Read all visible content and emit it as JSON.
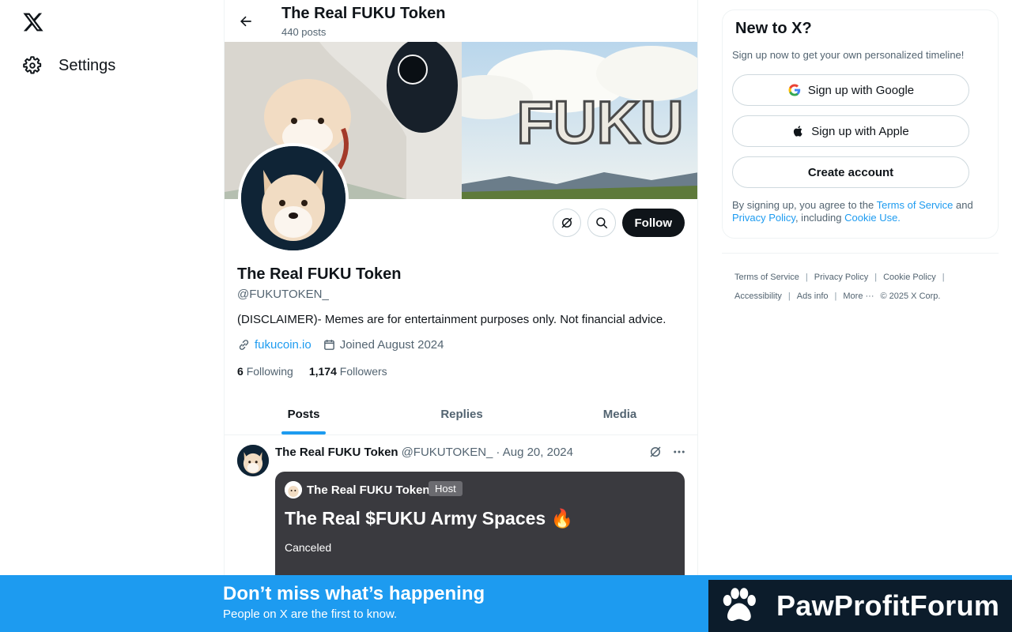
{
  "nav": {
    "settings_label": "Settings"
  },
  "header": {
    "title": "The Real FUKU Token",
    "posts_count": "440 posts"
  },
  "banner": {
    "text": "FUKU"
  },
  "profile": {
    "name": "The Real FUKU Token",
    "handle": "@FUKUTOKEN_",
    "bio": "(DISCLAIMER)- Memes are for entertainment purposes only. Not financial advice.",
    "website": "fukucoin.io",
    "joined": "Joined August 2024",
    "following_count": "6",
    "following_label": "Following",
    "followers_count": "1,174",
    "followers_label": "Followers",
    "follow_label": "Follow"
  },
  "tabs": [
    {
      "label": "Posts",
      "active": true
    },
    {
      "label": "Replies",
      "active": false
    },
    {
      "label": "Media",
      "active": false
    }
  ],
  "post": {
    "author": "The Real FUKU Token",
    "handle": "@FUKUTOKEN_",
    "date": "· Aug 20, 2024",
    "space": {
      "host_name": "The Real FUKU Token",
      "host_badge": "Host",
      "title": "The Real $FUKU Army Spaces 🔥",
      "status": "Canceled"
    }
  },
  "signup": {
    "title": "New to X?",
    "subtitle": "Sign up now to get your own personalized timeline!",
    "google": "Sign up with Google",
    "apple": "Sign up with Apple",
    "create": "Create account",
    "legal_prefix": "By signing up, you agree to the ",
    "terms": "Terms of Service",
    "and": " and ",
    "privacy": "Privacy Policy",
    "including": ", including ",
    "cookie": "Cookie Use."
  },
  "footer": {
    "terms": "Terms of Service",
    "privacy": "Privacy Policy",
    "cookie": "Cookie Policy",
    "accessibility": "Accessibility",
    "ads": "Ads info",
    "more": "More ···",
    "copyright": "© 2025 X Corp."
  },
  "bottom_bar": {
    "title": "Don’t miss what’s happening",
    "subtitle": "People on X are the first to know.",
    "brand": "PawProfitForum"
  },
  "colors": {
    "accent": "#1d9bf0",
    "text": "#0f1419",
    "muted": "#536471",
    "brand_bg": "#0c1c2b"
  }
}
